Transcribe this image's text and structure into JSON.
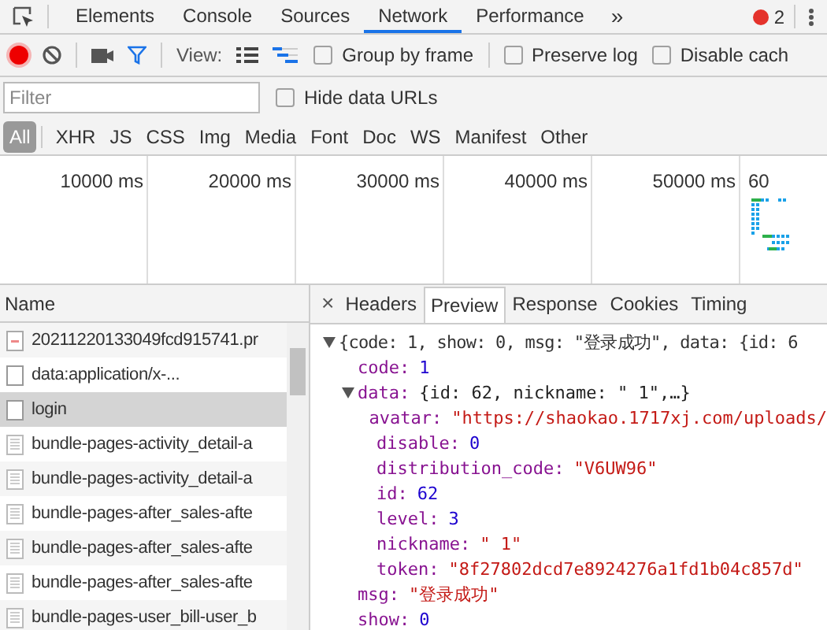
{
  "panel_tabs": [
    {
      "label": "Elements",
      "selected": false
    },
    {
      "label": "Console",
      "selected": false
    },
    {
      "label": "Sources",
      "selected": false
    },
    {
      "label": "Network",
      "selected": true
    },
    {
      "label": "Performance",
      "selected": false
    }
  ],
  "more_tabs": "»",
  "error_count": "2",
  "toolbar": {
    "recording": true,
    "filter_active": true,
    "view_label": "View:",
    "views": [
      {
        "kind": "list",
        "selected": false
      },
      {
        "kind": "waterfall",
        "selected": true
      }
    ],
    "options": [
      {
        "label": "Group by frame",
        "checked": false
      },
      {
        "label": "Preserve log",
        "checked": false
      },
      {
        "label": "Disable cach",
        "checked": false
      }
    ]
  },
  "filter": {
    "placeholder": "Filter",
    "hide_data_urls": {
      "label": "Hide data URLs",
      "checked": false
    }
  },
  "types": [
    {
      "label": "All",
      "selected": true
    },
    {
      "label": "XHR",
      "selected": false
    },
    {
      "label": "JS",
      "selected": false
    },
    {
      "label": "CSS",
      "selected": false
    },
    {
      "label": "Img",
      "selected": false
    },
    {
      "label": "Media",
      "selected": false
    },
    {
      "label": "Font",
      "selected": false
    },
    {
      "label": "Doc",
      "selected": false
    },
    {
      "label": "WS",
      "selected": false
    },
    {
      "label": "Manifest",
      "selected": false
    },
    {
      "label": "Other",
      "selected": false
    }
  ],
  "overview_ticks": [
    "10000 ms",
    "20000 ms",
    "30000 ms",
    "40000 ms",
    "50000 ms",
    "60"
  ],
  "requests": {
    "column": "Name",
    "rows": [
      {
        "name": "20211220133049fcd915741.pr",
        "kind": "image",
        "selected": false
      },
      {
        "name": "data:application/x-...",
        "kind": "blank",
        "selected": false
      },
      {
        "name": "login",
        "kind": "blank",
        "selected": true
      },
      {
        "name": "bundle-pages-activity_detail-a",
        "kind": "script",
        "selected": false
      },
      {
        "name": "bundle-pages-activity_detail-a",
        "kind": "script",
        "selected": false
      },
      {
        "name": "bundle-pages-after_sales-afte",
        "kind": "script",
        "selected": false
      },
      {
        "name": "bundle-pages-after_sales-afte",
        "kind": "script",
        "selected": false
      },
      {
        "name": "bundle-pages-after_sales-afte",
        "kind": "script",
        "selected": false
      },
      {
        "name": "bundle-pages-user_bill-user_b",
        "kind": "script",
        "selected": false
      }
    ]
  },
  "detail": {
    "close": "×",
    "tabs": [
      {
        "label": "Headers",
        "selected": false
      },
      {
        "label": "Preview",
        "selected": true
      },
      {
        "label": "Response",
        "selected": false
      },
      {
        "label": "Cookies",
        "selected": false
      },
      {
        "label": "Timing",
        "selected": false
      }
    ],
    "preview": {
      "summary": "{code: 1, show: 0, msg: \"登录成功\", data: {id: 6",
      "expanded": true,
      "children": [
        {
          "key": "code:",
          "value": "1",
          "kind": "number"
        },
        {
          "key": "data:",
          "value": "{id: 62, nickname: \"  1\",…}",
          "kind": "object",
          "expanded": true,
          "children": [
            {
              "key": "avatar:",
              "value": "\"https://shaokao.1717xj.com/uploads/",
              "kind": "string"
            },
            {
              "key": "disable:",
              "value": "0",
              "kind": "number"
            },
            {
              "key": "distribution_code:",
              "value": "\"V6UW96\"",
              "kind": "string"
            },
            {
              "key": "id:",
              "value": "62",
              "kind": "number"
            },
            {
              "key": "level:",
              "value": "3",
              "kind": "number"
            },
            {
              "key": "nickname:",
              "value": "\"  1\"",
              "kind": "string"
            },
            {
              "key": "token:",
              "value": "\"8f27802dcd7e8924276a1fd1b04c857d\"",
              "kind": "string"
            }
          ]
        },
        {
          "key": "msg:",
          "value": "\"登录成功\"",
          "kind": "string"
        },
        {
          "key": "show:",
          "value": "0",
          "kind": "number"
        }
      ]
    }
  }
}
